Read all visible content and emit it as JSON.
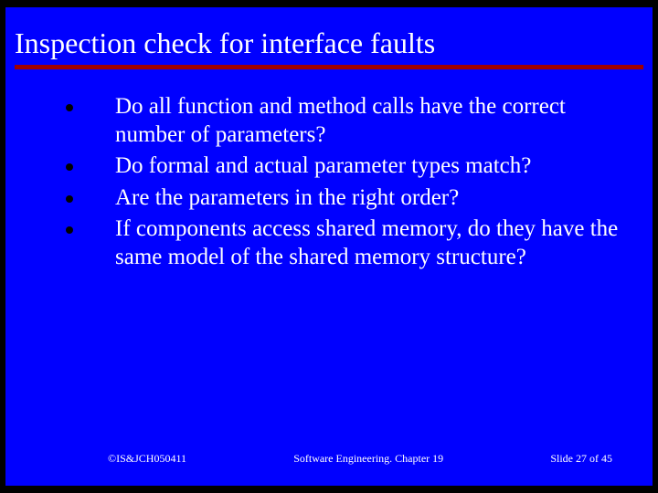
{
  "title": "Inspection check for interface faults",
  "bullets": [
    "Do all function and method calls have the correct number of parameters?",
    "Do formal and actual parameter types match?",
    "Are the parameters in the right order?",
    "If components access shared memory, do they have the same model of the shared memory structure?"
  ],
  "footer": {
    "left": "©IS&JCH050411",
    "center": "Software Engineering. Chapter 19",
    "right": "Slide 27 of 45"
  }
}
